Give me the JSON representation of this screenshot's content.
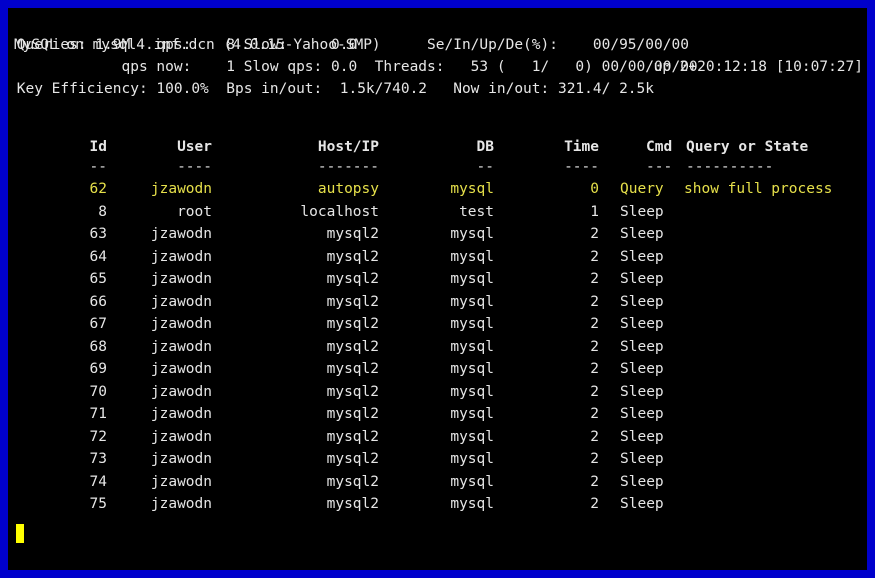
{
  "header": {
    "line1_left": "MySQL on mysql4.inf.dcn (4.0.15-Yahoo-SMP)",
    "line1_right": "up 2+20:12:18 [10:07:27]",
    "line2": " Queries: 1.9M   qps:    8 Slow:     0.0        Se/In/Up/De(%):    00/95/00/00",
    "line3": "             qps now:    1 Slow qps: 0.0  Threads:   53 (   1/   0) 00/00/00/00",
    "line4": " Key Efficiency: 100.0%  Bps in/out:  1.5k/740.2   Now in/out: 321.4/ 2.5k"
  },
  "columns": {
    "id": "Id",
    "user": "User",
    "host": "Host/IP",
    "db": "DB",
    "time": "Time",
    "cmd": "Cmd",
    "query": "Query or State",
    "id_u": "--",
    "user_u": "----",
    "host_u": "-------",
    "db_u": "--",
    "time_u": "----",
    "cmd_u": "---",
    "query_u": "----------"
  },
  "rows": [
    {
      "id": "62",
      "user": "jzawodn",
      "host": "autopsy",
      "db": "mysql",
      "time": "0",
      "cmd": "Query",
      "query": "show full process",
      "highlight": true
    },
    {
      "id": "8",
      "user": "root",
      "host": "localhost",
      "db": "test",
      "time": "1",
      "cmd": "Sleep",
      "query": ""
    },
    {
      "id": "63",
      "user": "jzawodn",
      "host": "mysql2",
      "db": "mysql",
      "time": "2",
      "cmd": "Sleep",
      "query": ""
    },
    {
      "id": "64",
      "user": "jzawodn",
      "host": "mysql2",
      "db": "mysql",
      "time": "2",
      "cmd": "Sleep",
      "query": ""
    },
    {
      "id": "65",
      "user": "jzawodn",
      "host": "mysql2",
      "db": "mysql",
      "time": "2",
      "cmd": "Sleep",
      "query": ""
    },
    {
      "id": "66",
      "user": "jzawodn",
      "host": "mysql2",
      "db": "mysql",
      "time": "2",
      "cmd": "Sleep",
      "query": ""
    },
    {
      "id": "67",
      "user": "jzawodn",
      "host": "mysql2",
      "db": "mysql",
      "time": "2",
      "cmd": "Sleep",
      "query": ""
    },
    {
      "id": "68",
      "user": "jzawodn",
      "host": "mysql2",
      "db": "mysql",
      "time": "2",
      "cmd": "Sleep",
      "query": ""
    },
    {
      "id": "69",
      "user": "jzawodn",
      "host": "mysql2",
      "db": "mysql",
      "time": "2",
      "cmd": "Sleep",
      "query": ""
    },
    {
      "id": "70",
      "user": "jzawodn",
      "host": "mysql2",
      "db": "mysql",
      "time": "2",
      "cmd": "Sleep",
      "query": ""
    },
    {
      "id": "71",
      "user": "jzawodn",
      "host": "mysql2",
      "db": "mysql",
      "time": "2",
      "cmd": "Sleep",
      "query": ""
    },
    {
      "id": "72",
      "user": "jzawodn",
      "host": "mysql2",
      "db": "mysql",
      "time": "2",
      "cmd": "Sleep",
      "query": ""
    },
    {
      "id": "73",
      "user": "jzawodn",
      "host": "mysql2",
      "db": "mysql",
      "time": "2",
      "cmd": "Sleep",
      "query": ""
    },
    {
      "id": "74",
      "user": "jzawodn",
      "host": "mysql2",
      "db": "mysql",
      "time": "2",
      "cmd": "Sleep",
      "query": ""
    },
    {
      "id": "75",
      "user": "jzawodn",
      "host": "mysql2",
      "db": "mysql",
      "time": "2",
      "cmd": "Sleep",
      "query": ""
    }
  ],
  "colors": {
    "frame": "#0000cc",
    "background": "#000000",
    "text": "#e6e6e6",
    "highlight": "#e6e04a",
    "cursor": "#ffff00"
  }
}
